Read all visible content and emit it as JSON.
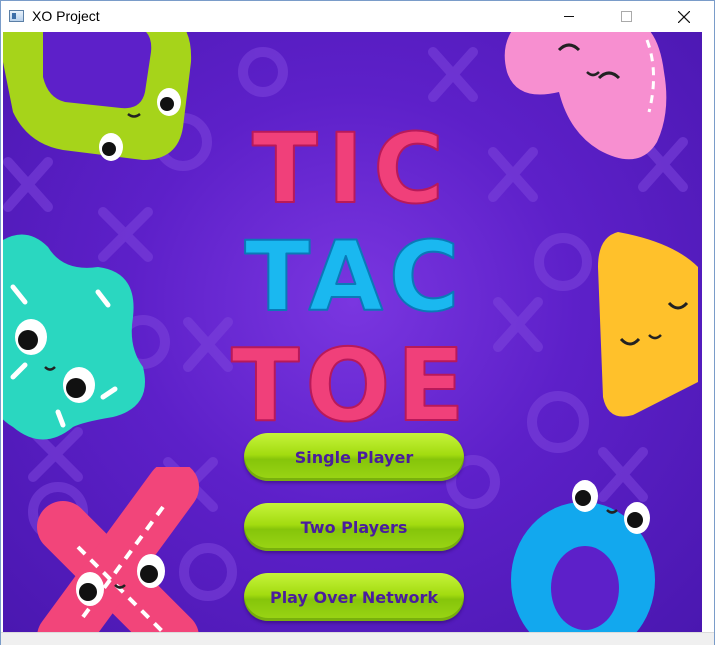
{
  "window": {
    "title": "XO Project",
    "controls": {
      "minimize": "minimize-icon",
      "maximize": "maximize-icon",
      "close": "close-icon"
    }
  },
  "logo": {
    "lines": [
      "TIC",
      "TAC",
      "TOE"
    ],
    "colors": {
      "pink": "#f0407a",
      "cyan": "#1ab8f0",
      "stitch": "#ffffff"
    }
  },
  "menu": {
    "single_player": "Single Player",
    "two_players": "Two Players",
    "play_over_network": "Play Over Network"
  },
  "decorations": [
    {
      "name": "green-square-character",
      "color": "#a6d41a"
    },
    {
      "name": "pink-heart-character",
      "color": "#f78fd0"
    },
    {
      "name": "cyan-flower-character",
      "color": "#2ad7c0"
    },
    {
      "name": "yellow-triangle-character",
      "color": "#ffc12b"
    },
    {
      "name": "pink-x-character",
      "color": "#f2457a"
    },
    {
      "name": "blue-o-character",
      "color": "#12a8ee"
    }
  ],
  "colors": {
    "background": "#5d20c9",
    "button": "#a3dc10",
    "button_text": "#4a1d9e"
  }
}
